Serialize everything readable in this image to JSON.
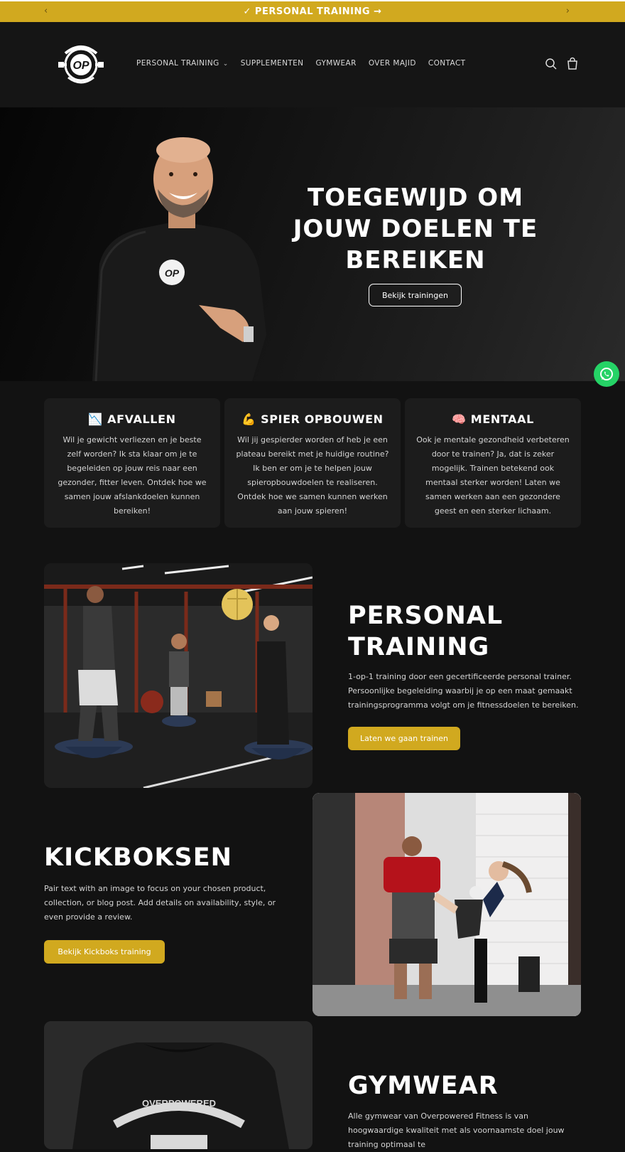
{
  "announcement": {
    "text": "✓ PERSONAL TRAINING →",
    "prev_icon": "‹",
    "next_icon": "›"
  },
  "header": {
    "logo_alt": "OVERPOWERED FITNESS logo",
    "nav": [
      {
        "label": "PERSONAL TRAINING",
        "has_dropdown": true
      },
      {
        "label": "SUPPLEMENTEN"
      },
      {
        "label": "GYMWEAR"
      },
      {
        "label": "OVER MAJID"
      },
      {
        "label": "CONTACT"
      }
    ],
    "dropdown_icon": "⌄"
  },
  "hero": {
    "title": "TOEGEWIJD OM\nJOUW DOELEN TE\nBEREIKEN",
    "button": "Bekijk trainingen"
  },
  "cards": [
    {
      "title": "📉 AFVALLEN",
      "text": "Wil je gewicht verliezen en je beste zelf worden? Ik sta klaar om je te begeleiden op jouw reis naar een gezonder, fitter leven. Ontdek hoe we samen jouw afslankdoelen kunnen bereiken!"
    },
    {
      "title": "💪 SPIER OPBOUWEN",
      "text": "Wil jij gespierder worden of heb je een plateau bereikt met je huidige routine? Ik ben er om je te helpen jouw spieropbouwdoelen te realiseren. Ontdek hoe we samen kunnen werken aan jouw spieren!"
    },
    {
      "title": "🧠 MENTAAL",
      "text": "Ook je mentale gezondheid verbeteren door te trainen? Ja, dat is zeker mogelijk. Trainen betekend ook mentaal sterker worden! Laten we samen werken aan een gezondere geest en een sterker lichaam."
    }
  ],
  "personal_training": {
    "title": "PERSONAL\nTRAINING",
    "text": "1-op-1 training door een gecertificeerde personal trainer. Persoonlijke begeleiding waarbij je op een maat gemaakt trainingsprogramma volgt om je fitnessdoelen te bereiken.",
    "button": "Laten we gaan trainen"
  },
  "kickboksen": {
    "title": "KICKBOKSEN",
    "text": "Pair text with an image to focus on your chosen product, collection, or blog post. Add details on availability, style, or even provide a review.",
    "button": "Bekijk Kickboks training"
  },
  "gymwear": {
    "title": "GYMWEAR",
    "text": "Alle gymwear van Overpowered Fitness is van hoogwaardige kwaliteit met als voornaamste doel jouw training optimaal te",
    "shirt_print": "OVERPOWERED"
  },
  "colors": {
    "gold": "#d1a91f",
    "background": "#121212",
    "card": "#1c1c1c",
    "whatsapp": "#25d366"
  }
}
